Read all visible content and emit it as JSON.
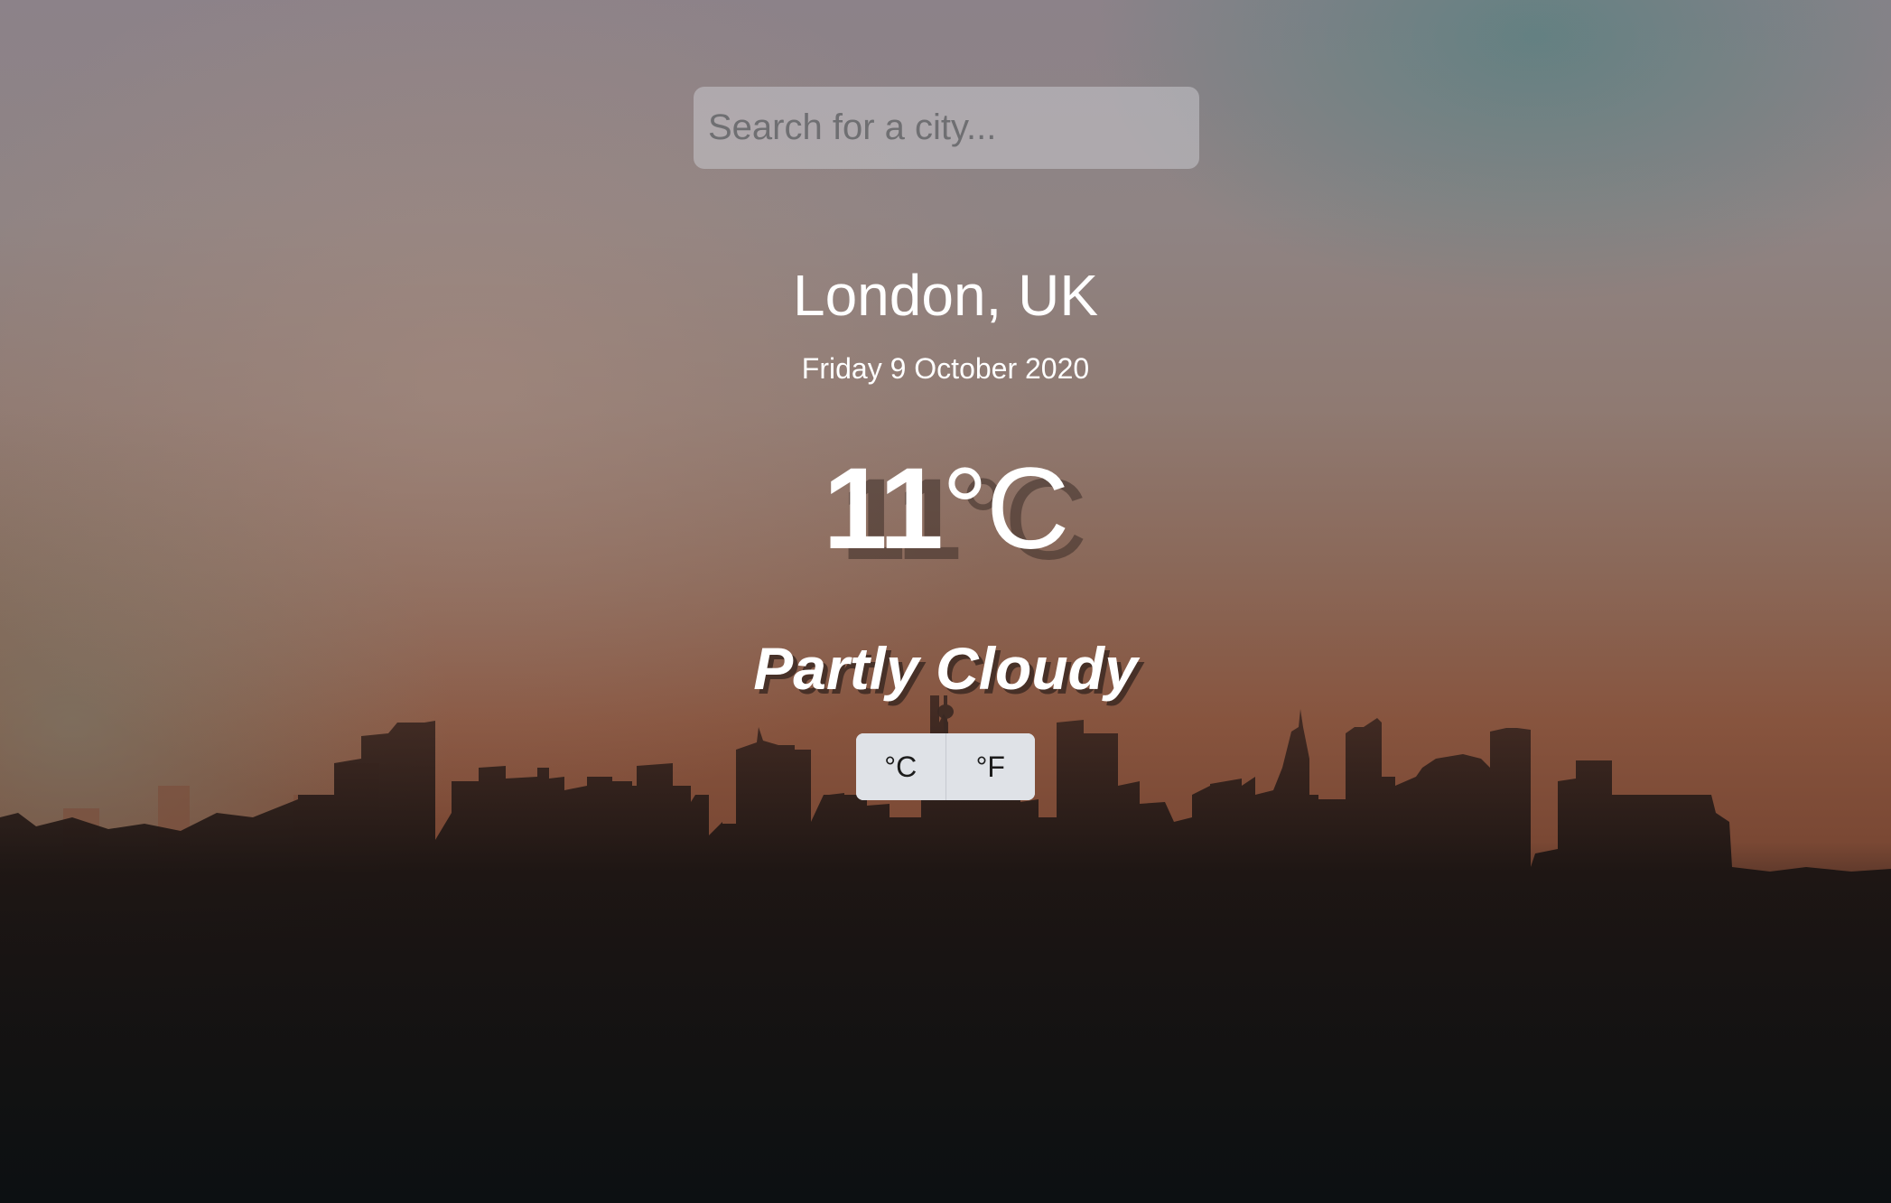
{
  "search": {
    "placeholder": "Search for a city...",
    "value": ""
  },
  "weather": {
    "location": "London, UK",
    "date": "Friday 9 October 2020",
    "temperature": "11",
    "temperature_unit": "°C",
    "condition": "Partly Cloudy"
  },
  "unit_toggle": {
    "celsius_label": "°C",
    "fahrenheit_label": "°F"
  },
  "background": {
    "description_icon": "city-skyline-sunset-image"
  }
}
